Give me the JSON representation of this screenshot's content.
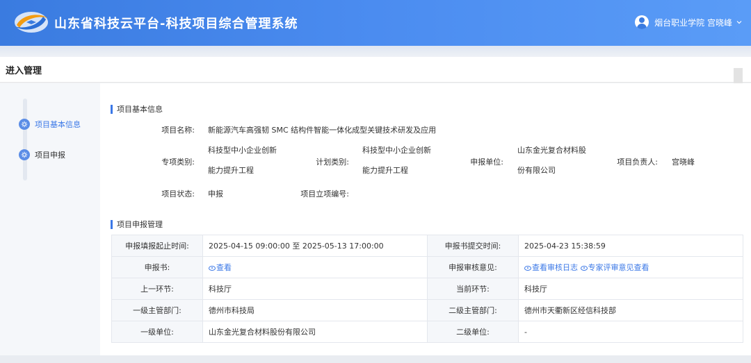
{
  "header": {
    "title": "山东省科技云平台-科技项目综合管理系统",
    "user": "烟台职业学院 宫晓峰",
    "colors": {
      "primary": "#3a7be0",
      "accent": "#3b78e7"
    },
    "icons": {
      "user": "user-avatar-icon",
      "chevron": "chevron-down-icon",
      "logo": "swoosh-logo"
    }
  },
  "page": {
    "title": "进入管理"
  },
  "sidebar": {
    "items": [
      {
        "label": "项目基本信息",
        "active": true,
        "icon": "gear-icon"
      },
      {
        "label": "项目申报",
        "active": false,
        "icon": "gear-icon"
      }
    ]
  },
  "basic": {
    "section_title": "项目基本信息",
    "project_name_label": "项目名称:",
    "project_name": "新能源汽车高强韧 SMC 结构件智能一体化成型关键技术研发及应用",
    "special_label": "专项类别:",
    "special_line1": "科技型中小企业创新",
    "special_line2": "能力提升工程",
    "plan_label": "计划类别:",
    "plan_line1": "科技型中小企业创新",
    "plan_line2": "能力提升工程",
    "unit_label": "申报单位:",
    "unit_line1": "山东金光复合材料股",
    "unit_line2": "份有限公司",
    "leader_label": "项目负责人:",
    "leader": "宫晓峰",
    "status_label": "项目状态:",
    "status": "申报",
    "approval_no_label": "项目立项编号:",
    "approval_no": ""
  },
  "manage": {
    "section_title": "项目申报管理",
    "rows": [
      {
        "k1": "申报填报起止时间:",
        "v1": "2025-04-15 09:00:00 至 2025-05-13 17:00:00",
        "k2": "申报书提交时间:",
        "v2": "2025-04-23 15:38:59"
      },
      {
        "k1": "申报书:",
        "v1": "查看",
        "k2": "申报审核意见:",
        "v2a": "查看审核日志",
        "v2b": "专家评审意见查看"
      },
      {
        "k1": "上一环节:",
        "v1": "科技厅",
        "k2": "当前环节:",
        "v2": "科技厅"
      },
      {
        "k1": "一级主管部门:",
        "v1": "德州市科技局",
        "k2": "二级主管部门:",
        "v2": "德州市天衢新区经信科技部"
      },
      {
        "k1": "一级单位:",
        "v1": "山东金光复合材料股份有限公司",
        "k2": "二级单位:",
        "v2": "-"
      }
    ]
  }
}
